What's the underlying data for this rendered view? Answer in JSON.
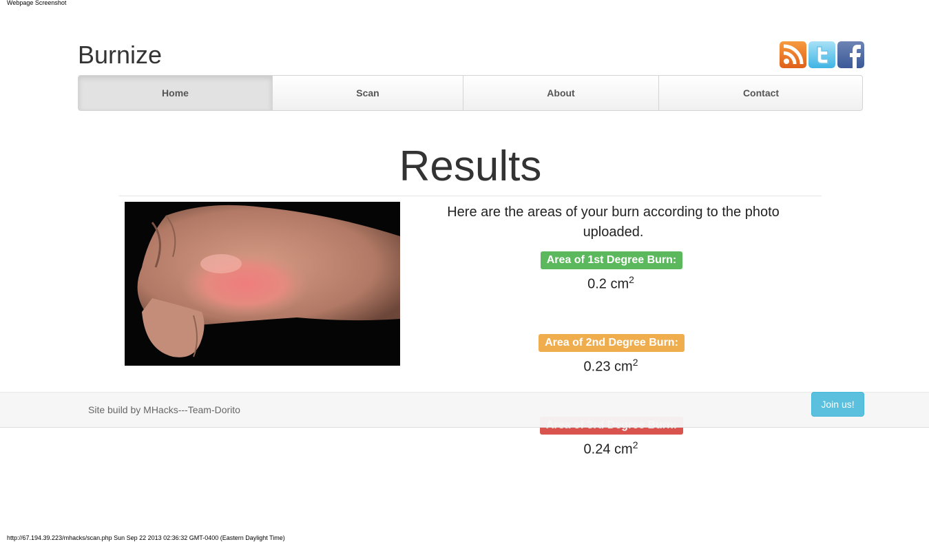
{
  "print_header": "Webpage Screenshot",
  "print_footer": "http://67.194.39.223/mhacks/scan.php Sun Sep 22 2013 02:36:32 GMT-0400 (Eastern Daylight Time)",
  "brand": "Burnize",
  "social": [
    "rss-icon",
    "twitter-icon",
    "facebook-icon"
  ],
  "nav": {
    "items": [
      {
        "label": "Home",
        "active": true
      },
      {
        "label": "Scan",
        "active": false
      },
      {
        "label": "About",
        "active": false
      },
      {
        "label": "Contact",
        "active": false
      }
    ]
  },
  "results": {
    "title": "Results",
    "intro": "Here are the areas of your burn according to the photo uploaded.",
    "areas": [
      {
        "label": "Area of 1st Degree Burn:",
        "value": "0.2",
        "unit": "cm",
        "exp": "2",
        "color": "#5cb85c"
      },
      {
        "label": "Area of 2nd Degree Burn:",
        "value": "0.23",
        "unit": "cm",
        "exp": "2",
        "color": "#f0ad4e"
      },
      {
        "label": "Area of 3rd Degree Burn:",
        "value": "0.24",
        "unit": "cm",
        "exp": "2",
        "color": "#d9534f"
      }
    ]
  },
  "footer": {
    "text": "Site build by MHacks---Team-Dorito",
    "join_label": "Join us!"
  }
}
